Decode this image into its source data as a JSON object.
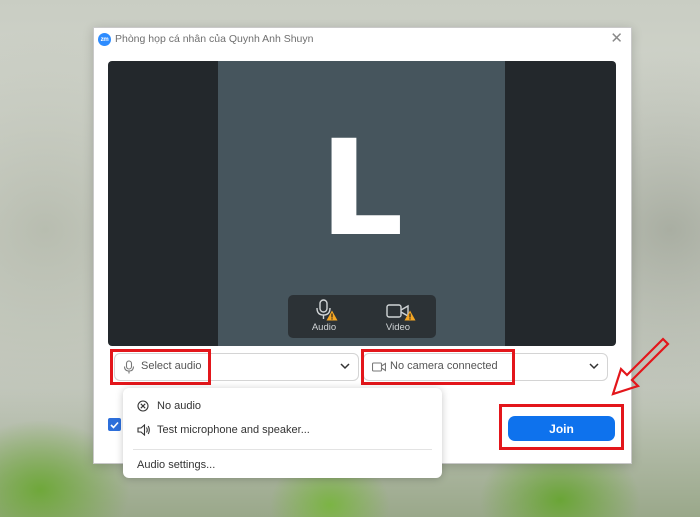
{
  "window": {
    "title": "Phòng họp cá nhân của Quynh Anh Shuyn",
    "logo_text": "zm",
    "close_icon": "close-icon"
  },
  "preview": {
    "avatar_letter": "L",
    "audio_label": "Audio",
    "video_label": "Video"
  },
  "audio_select": {
    "label": "Select audio"
  },
  "video_select": {
    "label": "No camera connected"
  },
  "audio_menu": {
    "items": [
      {
        "label": "No audio",
        "icon": "no-audio-icon"
      },
      {
        "label": "Test microphone and speaker...",
        "icon": "speaker-icon"
      },
      {
        "label": "Audio settings..."
      }
    ]
  },
  "join_button": {
    "label": "Join"
  },
  "colors": {
    "accent": "#0e72ed",
    "highlight": "#e3161b",
    "warning": "#f5a623",
    "preview_bg": "#46555d"
  }
}
